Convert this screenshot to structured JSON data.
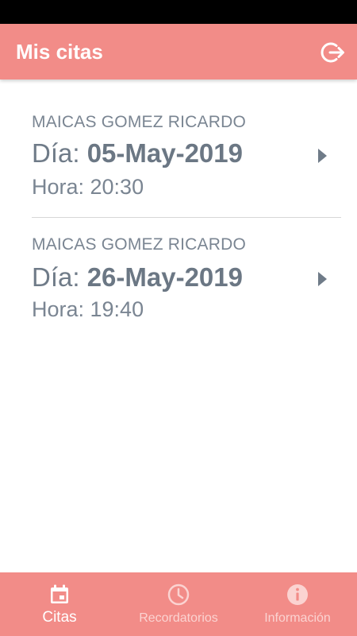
{
  "app_bar": {
    "title": "Mis citas",
    "logout_icon": "logout-icon"
  },
  "appointments": [
    {
      "name": "MAICAS GOMEZ RICARDO",
      "day_label": "Día:",
      "date": "05-May-2019",
      "time_label": "Hora: 20:30"
    },
    {
      "name": "MAICAS GOMEZ RICARDO",
      "day_label": "Día:",
      "date": "26-May-2019",
      "time_label": "Hora: 19:40"
    }
  ],
  "bottom_nav": {
    "items": [
      {
        "label": "Citas",
        "icon": "calendar-icon",
        "active": true
      },
      {
        "label": "Recordatorios",
        "icon": "clock-icon",
        "active": false
      },
      {
        "label": "Información",
        "icon": "info-icon",
        "active": false
      }
    ]
  },
  "colors": {
    "accent": "#f28c88",
    "text": "#6f7b88",
    "status_bar": "#000000"
  }
}
